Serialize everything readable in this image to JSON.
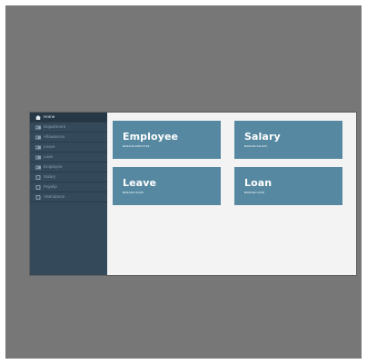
{
  "colors": {
    "sidebar_bg": "#34495a",
    "sidebar_active_bg": "#263746",
    "card_bg": "#5689a1",
    "content_bg": "#f3f3f3",
    "frame_bg": "#777777"
  },
  "sidebar": {
    "items": [
      {
        "label": "Home",
        "icon": "home-icon",
        "active": true
      },
      {
        "label": "Department",
        "icon": "id-card-icon"
      },
      {
        "label": "Allowances",
        "icon": "id-card-icon"
      },
      {
        "label": "Leave",
        "icon": "id-card-icon"
      },
      {
        "label": "Loan",
        "icon": "id-card-icon"
      },
      {
        "label": "Employee",
        "icon": "id-card-icon"
      },
      {
        "label": "Salary",
        "icon": "square-icon"
      },
      {
        "label": "Payslip",
        "icon": "square-icon"
      },
      {
        "label": "Attendance",
        "icon": "square-icon"
      }
    ]
  },
  "cards": [
    {
      "title": "Employee",
      "subtitle": "MANAGE EMPLOYEE"
    },
    {
      "title": "Salary",
      "subtitle": "MANAGE SALARY"
    },
    {
      "title": "Leave",
      "subtitle": "MANAGE LEAVE"
    },
    {
      "title": "Loan",
      "subtitle": "MANAGE LOAN"
    }
  ]
}
